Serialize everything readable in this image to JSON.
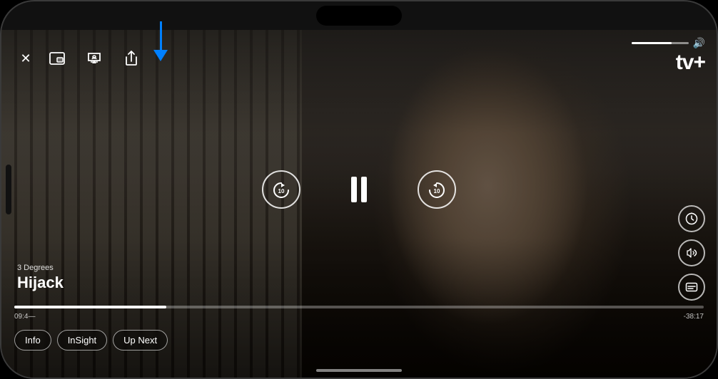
{
  "phone": {
    "frame_color": "#1a1a1a"
  },
  "header": {
    "close_label": "✕",
    "icons": [
      {
        "name": "picture-in-picture",
        "symbol": "⧉"
      },
      {
        "name": "airplay",
        "symbol": "⬛"
      },
      {
        "name": "share",
        "symbol": "↑"
      }
    ]
  },
  "brand": {
    "apple_symbol": "",
    "tv_text": "tv+",
    "full_label": "Apple TV+"
  },
  "volume": {
    "level": 70,
    "icon": "🔊"
  },
  "show": {
    "subtitle": "3 Degrees",
    "title": "Hijack"
  },
  "controls": {
    "rewind_seconds": "10",
    "forward_seconds": "10",
    "play_state": "pause"
  },
  "progress": {
    "elapsed": "09:4—",
    "remaining": "-38:17",
    "percent": 22
  },
  "arrow_indicator": {
    "color": "#0080ff"
  },
  "bottom_tabs": [
    {
      "id": "info",
      "label": "Info",
      "active": false
    },
    {
      "id": "insight",
      "label": "InSight",
      "active": false
    },
    {
      "id": "up_next",
      "label": "Up Next",
      "active": false
    }
  ],
  "right_controls": [
    {
      "id": "speed",
      "symbol": "⏱"
    },
    {
      "id": "audio",
      "symbol": "🎵"
    },
    {
      "id": "subtitles",
      "symbol": "💬"
    }
  ]
}
